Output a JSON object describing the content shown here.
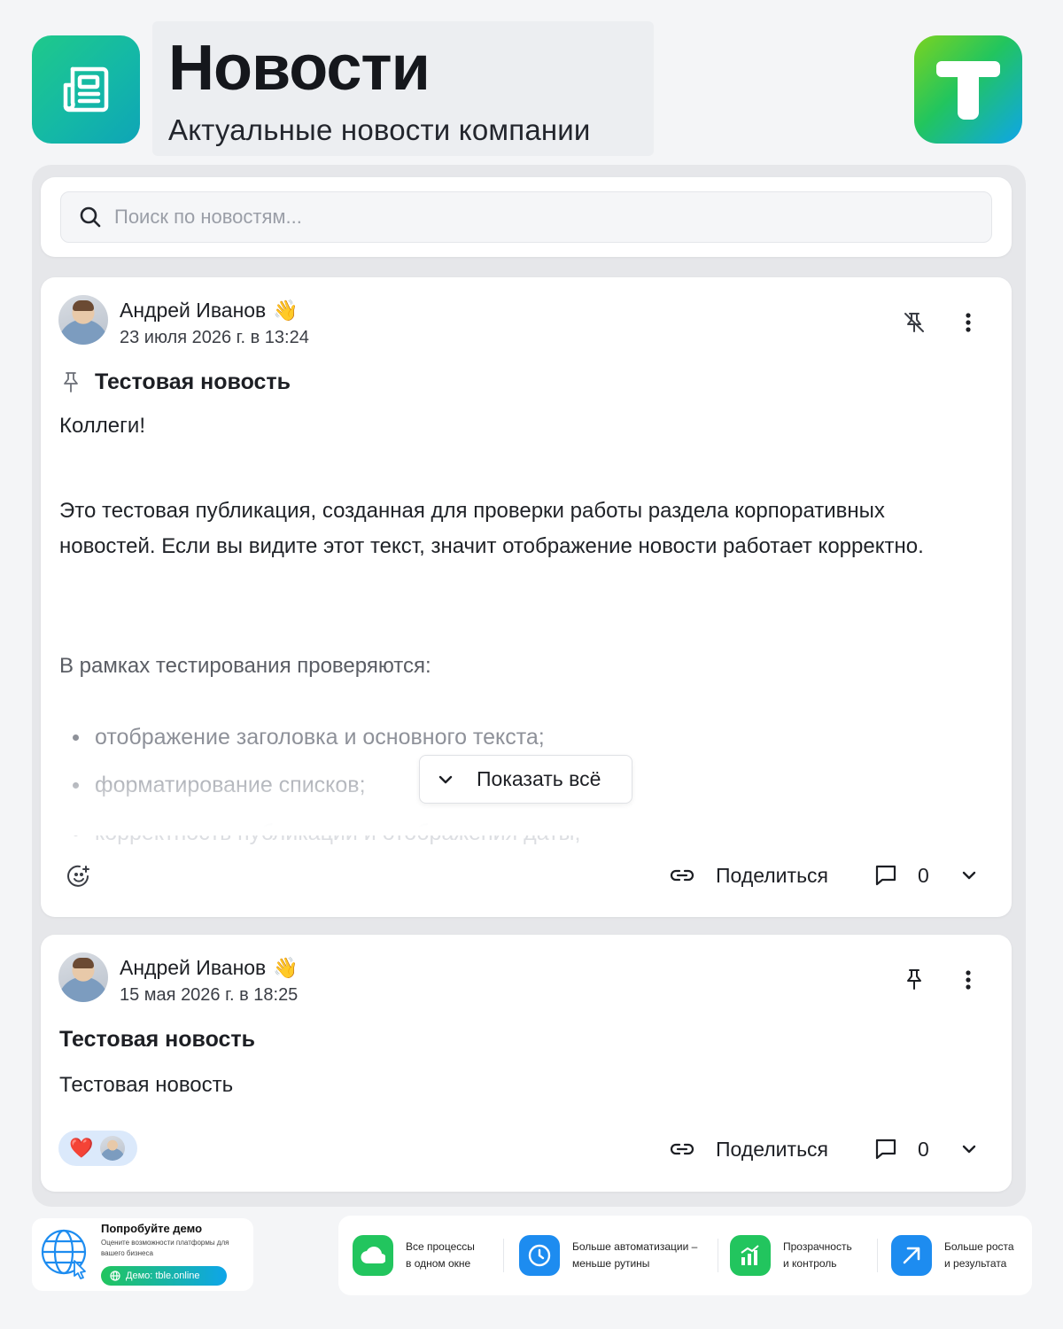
{
  "header": {
    "title": "Новости",
    "subtitle": "Актуальные новости компании",
    "brand_logo_letter": "T",
    "app_icon": "newspaper-icon"
  },
  "search": {
    "placeholder": "Поиск по новостям..."
  },
  "posts": [
    {
      "author": "Андрей Иванов",
      "author_emoji": "👋",
      "date": "23 июля 2026 г. в 13:24",
      "pinned": true,
      "title": "Тестовая новость",
      "greeting": "Коллеги!",
      "paragraph_1": "Это тестовая публикация, созданная для проверки работы раздела корпоративных новостей. Если вы видите этот текст, значит отображение новости работает корректно.",
      "paragraph_2": "В рамках тестирования проверяются:",
      "bullets": [
        "отображение заголовка и основного текста;",
        "форматирование списков;",
        "корректность публикации и отображения даты;"
      ],
      "show_all_label": "Показать всё",
      "share_label": "Поделиться",
      "comments_count": "0"
    },
    {
      "author": "Андрей Иванов",
      "author_emoji": "👋",
      "date": "15 мая 2026 г. в 18:25",
      "pinned": false,
      "title": "Тестовая новость",
      "body": "Тестовая новость",
      "reaction_emoji": "❤️",
      "share_label": "Поделиться",
      "comments_count": "0"
    }
  ],
  "promo": {
    "title": "Попробуйте демо",
    "subtitle": "Оцените возможности платформы для вашего бизнеса",
    "button_label": "Демо: tble.online"
  },
  "features": [
    {
      "text": "Все процессы\nв одном окне",
      "icon": "cloud-icon",
      "color": "#22c55e"
    },
    {
      "text": "Больше автоматизации –\nменьше рутины",
      "icon": "clock-icon",
      "color": "#1d8cf0"
    },
    {
      "text": "Прозрачность\nи контроль",
      "icon": "bar-chart-icon",
      "color": "#22c55e"
    },
    {
      "text": "Больше роста\nи результата",
      "icon": "arrow-up-right-icon",
      "color": "#1d8cf0"
    }
  ],
  "colors": {
    "brand_green": "#1fc98a",
    "brand_blue": "#0ea5e9",
    "reaction_bg": "#dbe9fb"
  }
}
